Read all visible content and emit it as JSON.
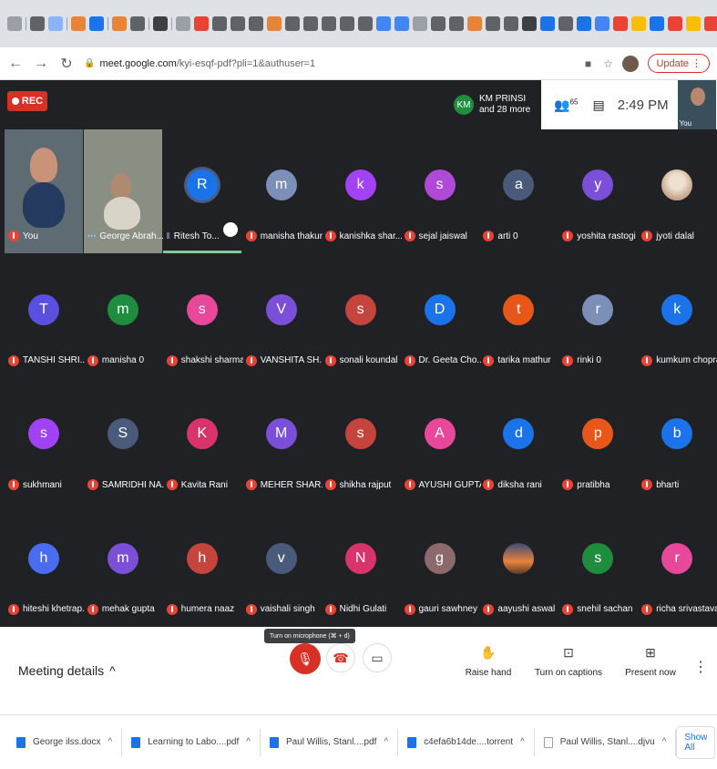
{
  "browser": {
    "url_host": "meet.google.com",
    "url_path": "/kyi-esqf-pdf?pli=1&authuser=1",
    "update_label": "Update",
    "new_tab": "+",
    "active_tab_close": "×"
  },
  "meet": {
    "rec_label": "REC",
    "presenter_initials": "KM",
    "presenter_line1": "KM PRINSI",
    "presenter_line2": "and 28 more",
    "people_count": "65",
    "time": "2:49 PM",
    "self_label": "You"
  },
  "participants": [
    {
      "name": "You",
      "type": "video",
      "muted": true
    },
    {
      "name": "George Abrah...",
      "type": "video2",
      "muted": false,
      "dots": true
    },
    {
      "name": "Ritesh To...",
      "initial": "R",
      "color": "#1a73e8",
      "muted": false,
      "speaking": true
    },
    {
      "name": "manisha thakur",
      "initial": "m",
      "color": "#7b8fb8",
      "muted": true
    },
    {
      "name": "kanishka shar...",
      "initial": "k",
      "color": "#a142f4",
      "muted": true
    },
    {
      "name": "sejal jaiswal",
      "initial": "s",
      "color": "#b048d8",
      "muted": true
    },
    {
      "name": "arti 0",
      "initial": "a",
      "color": "#4a5a7a",
      "muted": true
    },
    {
      "name": "yoshita rastogi",
      "initial": "y",
      "color": "#7b4fd8",
      "muted": true
    },
    {
      "name": "jyoti dalal",
      "initial": "",
      "color": "#d9c7b8",
      "muted": true,
      "photo": true
    },
    {
      "name": "TANSHI SHRI...",
      "initial": "T",
      "color": "#5b4fe0",
      "muted": true
    },
    {
      "name": "manisha 0",
      "initial": "m",
      "color": "#1e8e3e",
      "muted": true
    },
    {
      "name": "shakshi sharma",
      "initial": "s",
      "color": "#e8489a",
      "muted": true
    },
    {
      "name": "VANSHITA SH...",
      "initial": "V",
      "color": "#7b4fd8",
      "muted": true
    },
    {
      "name": "sonali koundal",
      "initial": "s",
      "color": "#c5443b",
      "muted": true
    },
    {
      "name": "Dr. Geeta Cho...",
      "initial": "D",
      "color": "#1a73e8",
      "muted": true
    },
    {
      "name": "tarika mathur",
      "initial": "t",
      "color": "#e8571a",
      "muted": true
    },
    {
      "name": "rinki 0",
      "initial": "r",
      "color": "#7b8fb8",
      "muted": true
    },
    {
      "name": "kumkum chopra",
      "initial": "k",
      "color": "#1a73e8",
      "muted": true
    },
    {
      "name": "sukhmani",
      "initial": "s",
      "color": "#a142f4",
      "muted": true
    },
    {
      "name": "SAMRIDHI NA...",
      "initial": "S",
      "color": "#4a5a7a",
      "muted": true
    },
    {
      "name": "Kavita Rani",
      "initial": "K",
      "color": "#d8336a",
      "muted": true
    },
    {
      "name": "MEHER SHAR...",
      "initial": "M",
      "color": "#7b4fd8",
      "muted": true
    },
    {
      "name": "shikha rajput",
      "initial": "s",
      "color": "#c5443b",
      "muted": true
    },
    {
      "name": "AYUSHI GUPTA",
      "initial": "A",
      "color": "#e8489a",
      "muted": true
    },
    {
      "name": "diksha rani",
      "initial": "d",
      "color": "#1a73e8",
      "muted": true
    },
    {
      "name": "pratibha",
      "initial": "p",
      "color": "#e8571a",
      "muted": true
    },
    {
      "name": "bharti",
      "initial": "b",
      "color": "#1a73e8",
      "muted": true
    },
    {
      "name": "hiteshi khetrap...",
      "initial": "h",
      "color": "#4a6cf0",
      "muted": true
    },
    {
      "name": "mehak gupta",
      "initial": "m",
      "color": "#7b4fd8",
      "muted": true
    },
    {
      "name": "humera naaz",
      "initial": "h",
      "color": "#c5443b",
      "muted": true
    },
    {
      "name": "vaishali singh",
      "initial": "v",
      "color": "#4a5a7a",
      "muted": true
    },
    {
      "name": "Nidhi Gulati",
      "initial": "N",
      "color": "#d8336a",
      "muted": true
    },
    {
      "name": "gauri sawhney",
      "initial": "g",
      "color": "#8a6a6a",
      "muted": true
    },
    {
      "name": "aayushi aswal",
      "initial": "",
      "color": "#e8833a",
      "muted": true,
      "photo": true
    },
    {
      "name": "snehil sachan",
      "initial": "s",
      "color": "#1e8e3e",
      "muted": true
    },
    {
      "name": "richa srivastava",
      "initial": "r",
      "color": "#e8489a",
      "muted": true
    }
  ],
  "controls": {
    "meeting_details": "Meeting details",
    "meeting_details_chevron": "^",
    "tooltip": "Turn on microphone (⌘ + d)",
    "raise_hand": "Raise hand",
    "captions": "Turn on captions",
    "present": "Present now"
  },
  "downloads": {
    "items": [
      {
        "name": "George ilss.docx",
        "plain": false
      },
      {
        "name": "Learning to Labo....pdf",
        "plain": false
      },
      {
        "name": "Paul Willis, Stanl....pdf",
        "plain": false
      },
      {
        "name": "c4efa6b14de....torrent",
        "plain": false
      },
      {
        "name": "Paul Willis, Stanl....djvu",
        "plain": true
      }
    ],
    "show_all": "Show All",
    "close": "X"
  },
  "colors": {
    "meet_bg": "#202124",
    "rec": "#d93025",
    "muted_badge": "#ea4335",
    "link": "#1a73e8"
  }
}
